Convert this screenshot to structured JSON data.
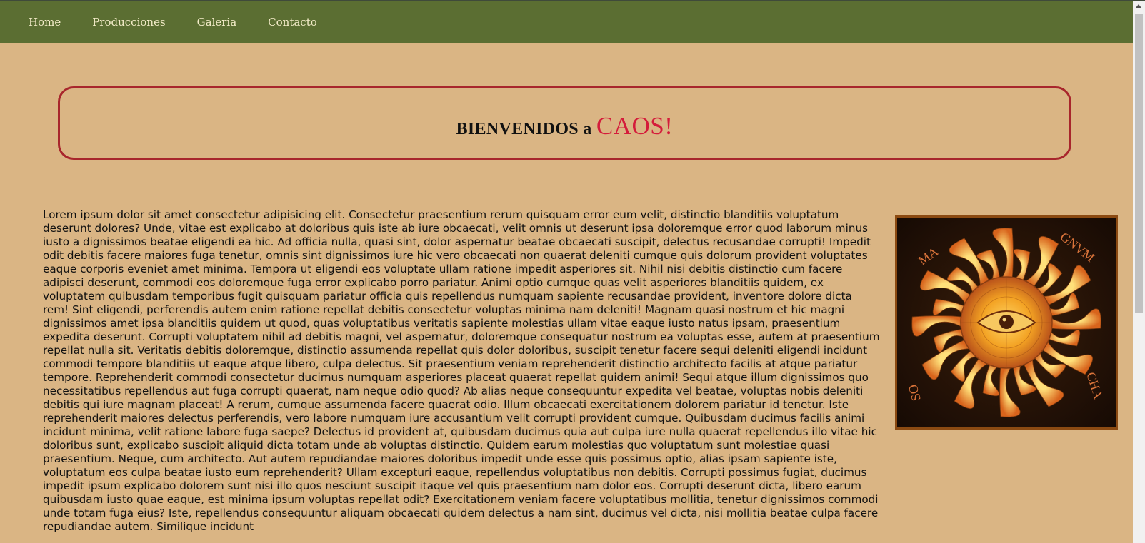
{
  "nav": {
    "items": [
      {
        "label": "Home"
      },
      {
        "label": "Producciones"
      },
      {
        "label": "Galeria"
      },
      {
        "label": "Contacto"
      }
    ]
  },
  "hero": {
    "title_prefix": "BIENVENIDOS a ",
    "title_brand": "CAOS!"
  },
  "content": {
    "paragraph": "Lorem ipsum dolor sit amet consectetur adipisicing elit. Consectetur praesentium rerum quisquam error eum velit, distinctio blanditiis voluptatum deserunt dolores? Unde, vitae est explicabo at doloribus quis iste ab iure obcaecati, velit omnis ut deserunt ipsa doloremque error quod laborum minus iusto a dignissimos beatae eligendi ea hic. Ad officia nulla, quasi sint, dolor aspernatur beatae obcaecati suscipit, delectus recusandae corrupti! Impedit odit debitis facere maiores fuga tenetur, omnis sint dignissimos iure hic vero obcaecati non quaerat deleniti cumque quis dolorum provident voluptates eaque corporis eveniet amet minima. Tempora ut eligendi eos voluptate ullam ratione impedit asperiores sit. Nihil nisi debitis distinctio cum facere adipisci deserunt, commodi eos doloremque fuga error explicabo porro pariatur. Animi optio cumque quas velit asperiores blanditiis quidem, ex voluptatem quibusdam temporibus fugit quisquam pariatur officia quis repellendus numquam sapiente recusandae provident, inventore dolore dicta rem! Sint eligendi, perferendis autem enim ratione repellat debitis consectetur voluptas minima nam deleniti! Magnam quasi nostrum et hic magni dignissimos amet ipsa blanditiis quidem ut quod, quas voluptatibus veritatis sapiente molestias ullam vitae eaque iusto natus ipsam, praesentium expedita deserunt. Corrupti voluptatem nihil ad debitis magni, vel aspernatur, doloremque consequatur nostrum ea voluptas esse, autem at praesentium repellat nulla sit. Veritatis debitis doloremque, distinctio assumenda repellat quis dolor doloribus, suscipit tenetur facere sequi deleniti eligendi incidunt commodi tempore blanditiis ut eaque atque libero, culpa delectus. Sit praesentium veniam reprehenderit distinctio architecto facilis at atque pariatur tempore. Reprehenderit commodi consectetur ducimus numquam asperiores placeat quaerat repellat quidem animi! Sequi atque illum dignissimos quo necessitatibus repellendus aut fuga corrupti quaerat, nam neque odio quod? Ab alias neque consequuntur expedita vel beatae, voluptas nobis deleniti debitis qui iure magnam placeat! A rerum, cumque assumenda facere quaerat odio. Illum obcaecati exercitationem dolorem pariatur id tenetur. Iste reprehenderit maiores delectus perferendis, vero labore numquam iure accusantium velit corrupti provident cumque. Quibusdam ducimus facilis animi incidunt minima, velit ratione labore fuga saepe? Delectus id provident at, quibusdam ducimus quia aut culpa iure nulla quaerat repellendus illo vitae hic doloribus sunt, explicabo suscipit aliquid dicta totam unde ab voluptas distinctio. Quidem earum molestias quo voluptatum sunt molestiae quasi praesentium. Neque, cum architecto. Aut autem repudiandae maiores doloribus impedit unde esse quis possimus optio, alias ipsam sapiente iste, voluptatum eos culpa beatae iusto eum reprehenderit? Ullam excepturi eaque, repellendus voluptatibus non debitis. Corrupti possimus fugiat, ducimus impedit ipsum explicabo dolorem sunt nisi illo quos nesciunt suscipit itaque vel quis praesentium nam dolor eos. Corrupti deserunt dicta, libero earum quibusdam iusto quae eaque, est minima ipsum voluptas repellat odit? Exercitationem veniam facere voluptatibus mollitia, tenetur dignissimos commodi unde totam fuga eius? Iste, repellendus consequuntur aliquam obcaecati quidem delectus a nam sint, ducimus vel dicta, nisi mollitia beatae culpa facere repudiandae autem. Similique incidunt"
  },
  "image": {
    "inscription_left": "MA",
    "inscription_right": "GNVM",
    "inscription_bottom_left": "SO",
    "inscription_bottom_right": "CHA"
  },
  "colors": {
    "page_bg": "#dab584",
    "nav_bg": "#5b6e32",
    "box_border": "#a8262c",
    "brand": "#d41c3b"
  }
}
